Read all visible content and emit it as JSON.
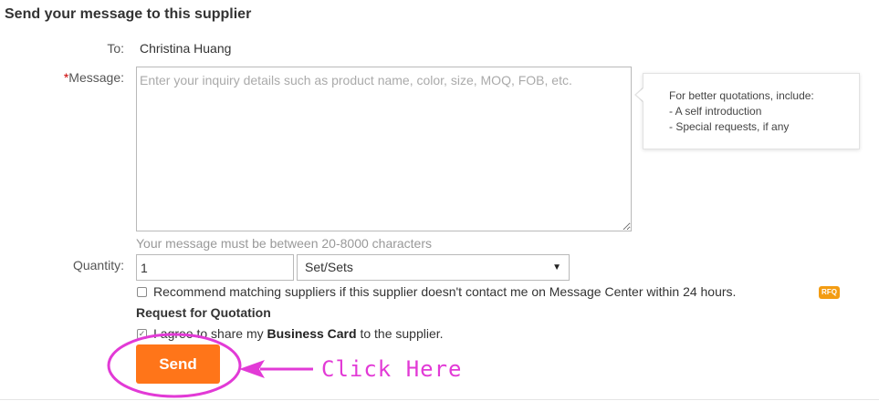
{
  "form": {
    "title": "Send your message to this supplier",
    "to_label": "To:",
    "to_value": "Christina Huang",
    "message_required_mark": "*",
    "message_label": "Message:",
    "message_placeholder": "Enter your inquiry details such as product name, color, size, MOQ, FOB, etc.",
    "message_hint": "Your message must be between 20-8000 characters",
    "quantity_label": "Quantity:",
    "quantity_value": "1",
    "unit_selected": "Set/Sets",
    "recommend_checked": false,
    "recommend_text": "Recommend matching suppliers if this supplier doesn't contact me on Message Center within 24 hours.",
    "rfq_badge": "RFQ",
    "rfq_title": "Request for Quotation",
    "agree_checked": true,
    "agree_prefix": "I agree to share my ",
    "agree_bold": "Business Card",
    "agree_suffix": " to the supplier.",
    "send_label": "Send"
  },
  "tip": {
    "heading": "For better quotations, include:",
    "items": [
      "- A self introduction",
      "- Special requests, if any"
    ]
  },
  "annotation": {
    "text": "Click Here",
    "color": "#e23ad6"
  },
  "colors": {
    "send_button": "#ff7519",
    "required": "#cc0000",
    "hint": "#999999",
    "rfq_badge": "#f39c12"
  }
}
